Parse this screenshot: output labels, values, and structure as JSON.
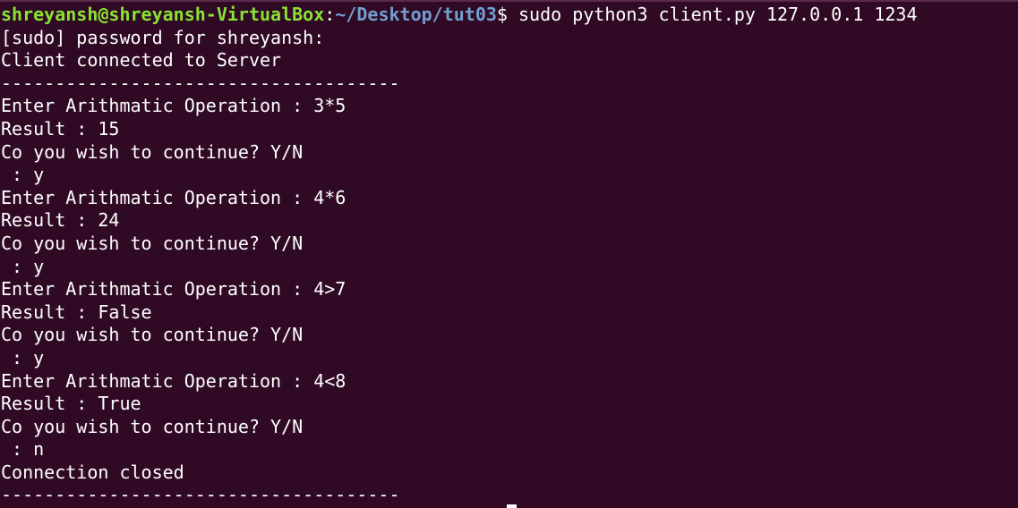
{
  "prompt": {
    "user_host": "shreyansh@shreyansh-VirtualBox",
    "colon": ":",
    "path": "~/Desktop/tut03",
    "symbol": "$",
    "command": " sudo python3 client.py 127.0.0.1 1234"
  },
  "output_lines": [
    "[sudo] password for shreyansh:",
    "Client connected to Server",
    "-------------------------------------",
    "Enter Arithmatic Operation : 3*5",
    "Result : 15",
    "Co you wish to continue? Y/N",
    " : y",
    "Enter Arithmatic Operation : 4*6",
    "Result : 24",
    "Co you wish to continue? Y/N",
    " : y",
    "Enter Arithmatic Operation : 4>7",
    "Result : False",
    "Co you wish to continue? Y/N",
    " : y",
    "Enter Arithmatic Operation : 4<8",
    "Result : True",
    "Co you wish to continue? Y/N",
    " : n",
    "Connection closed",
    "-------------------------------------"
  ],
  "colors": {
    "background": "#300a24",
    "user_host": "#8ae234",
    "path": "#729fcf",
    "text": "#ffffff"
  }
}
